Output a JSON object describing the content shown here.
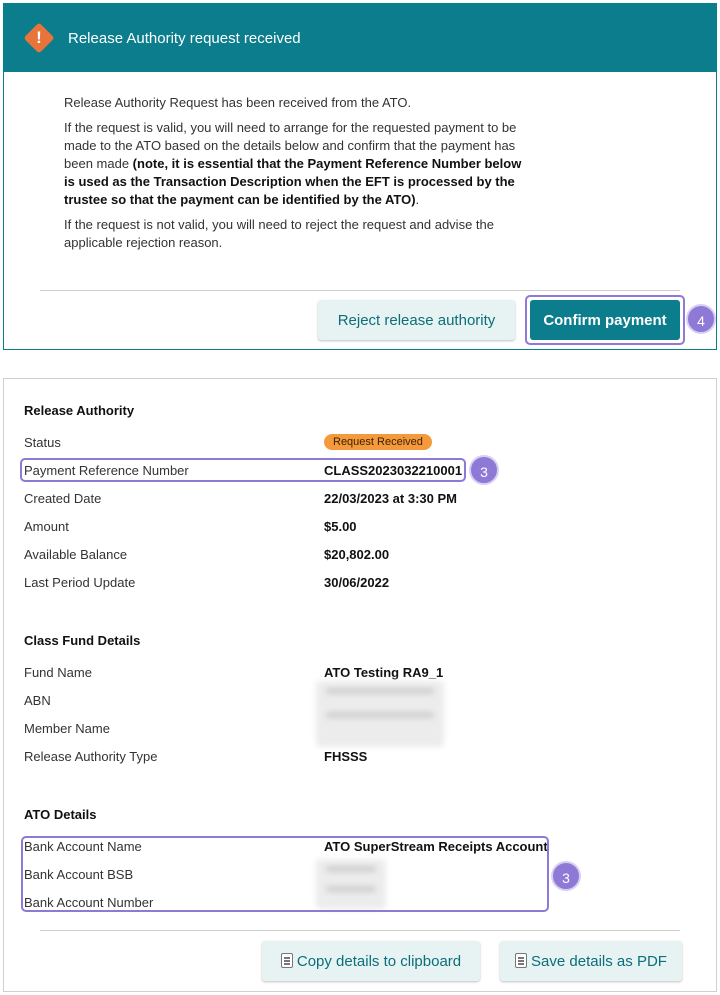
{
  "notice": {
    "title": "Release Authority request received",
    "p1": "Release Authority Request has been received from the ATO.",
    "p2_plain": "If the request is valid, you will need to arrange for the requested payment to be made to the ATO based on the details below and confirm that the payment has been made ",
    "p2_bold": "(note, it is essential that the Payment Reference Number below is used as the Transaction Description when the EFT is processed by the trustee so that the payment can be identified by the ATO)",
    "p2_end": ".",
    "p3": "If the request is not valid, you will need to reject the request and advise the applicable rejection reason.",
    "reject_label": "Reject release authority",
    "confirm_label": "Confirm payment",
    "step_confirm": "4"
  },
  "release_authority": {
    "title": "Release Authority",
    "status_label": "Status",
    "status_value": "Request Received",
    "prn_label": "Payment Reference Number",
    "prn_value": "CLASS2023032210001",
    "created_label": "Created Date",
    "created_value": "22/03/2023 at 3:30 PM",
    "amount_label": "Amount",
    "amount_value": "$5.00",
    "balance_label": "Available Balance",
    "balance_value": "$20,802.00",
    "last_update_label": "Last Period Update",
    "last_update_value": "30/06/2022",
    "step_prn": "3"
  },
  "class_fund": {
    "title": "Class Fund Details",
    "fund_name_label": "Fund Name",
    "fund_name_value": "ATO Testing RA9_1",
    "abn_label": "ABN",
    "member_label": "Member Name",
    "type_label": "Release Authority Type",
    "type_value": "FHSSS"
  },
  "ato": {
    "title": "ATO Details",
    "bank_name_label": "Bank Account Name",
    "bank_name_value": "ATO SuperStream Receipts Account",
    "bsb_label": "Bank Account BSB",
    "number_label": "Bank Account Number",
    "step_bank": "3"
  },
  "actions": {
    "copy_label": "Copy details to clipboard",
    "pdf_label": "Save details as PDF"
  },
  "icons": {
    "warning": "warning-diamond-icon",
    "copy": "clipboard-icon",
    "pdf": "pdf-icon"
  },
  "colors": {
    "primary": "#0b7d8c",
    "warning": "#e8743b",
    "status": "#f59a3c",
    "highlight": "#8f79d6"
  }
}
